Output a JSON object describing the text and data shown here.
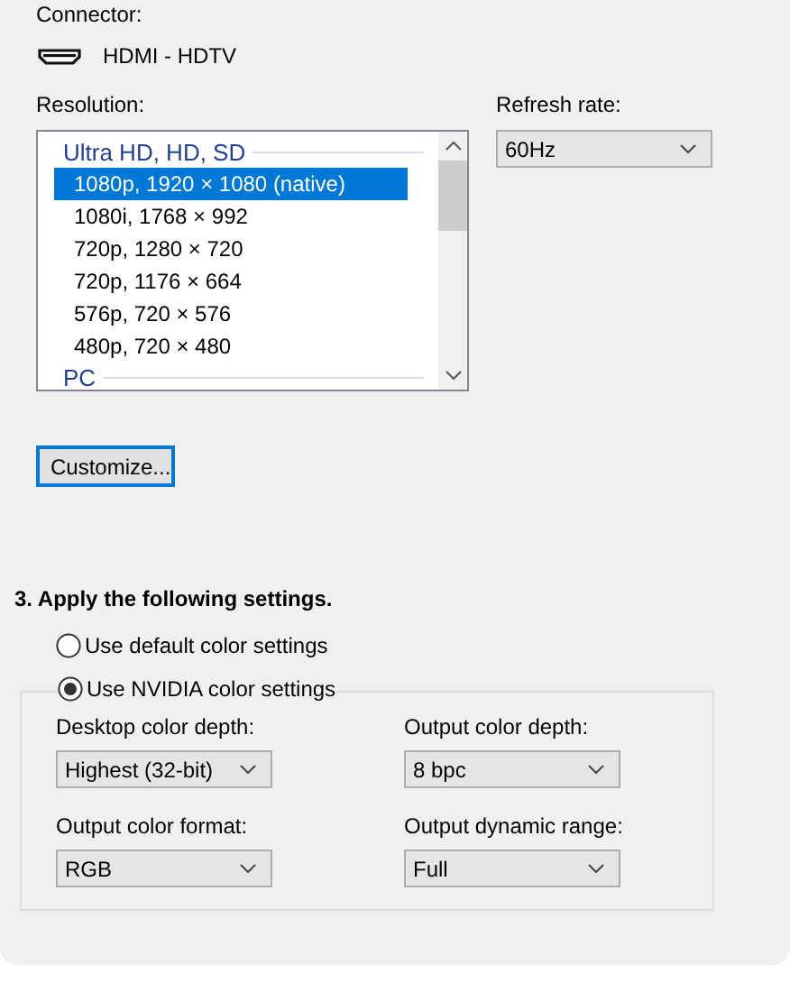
{
  "connector": {
    "label": "Connector:",
    "value": "HDMI - HDTV"
  },
  "resolution": {
    "label": "Resolution:",
    "groups": [
      {
        "title": "Ultra HD, HD, SD",
        "items": [
          {
            "label": "1080p, 1920 × 1080 (native)",
            "selected": true
          },
          {
            "label": "1080i, 1768 × 992",
            "selected": false
          },
          {
            "label": "720p, 1280 × 720",
            "selected": false
          },
          {
            "label": "720p, 1176 × 664",
            "selected": false
          },
          {
            "label": "576p, 720 × 576",
            "selected": false
          },
          {
            "label": "480p, 720 × 480",
            "selected": false
          }
        ]
      },
      {
        "title": "PC"
      }
    ]
  },
  "refresh_rate": {
    "label": "Refresh rate:",
    "value": "60Hz"
  },
  "customize_button": {
    "label": "Customize..."
  },
  "section": {
    "title": "3. Apply the following settings.",
    "options": [
      {
        "label": "Use default color settings",
        "selected": false
      },
      {
        "label": "Use NVIDIA color settings",
        "selected": true
      }
    ],
    "fields": [
      {
        "label": "Desktop color depth:",
        "value": "Highest (32-bit)"
      },
      {
        "label": "Output color depth:",
        "value": "8 bpc"
      },
      {
        "label": "Output color format:",
        "value": "RGB"
      },
      {
        "label": "Output dynamic range:",
        "value": "Full"
      }
    ]
  }
}
